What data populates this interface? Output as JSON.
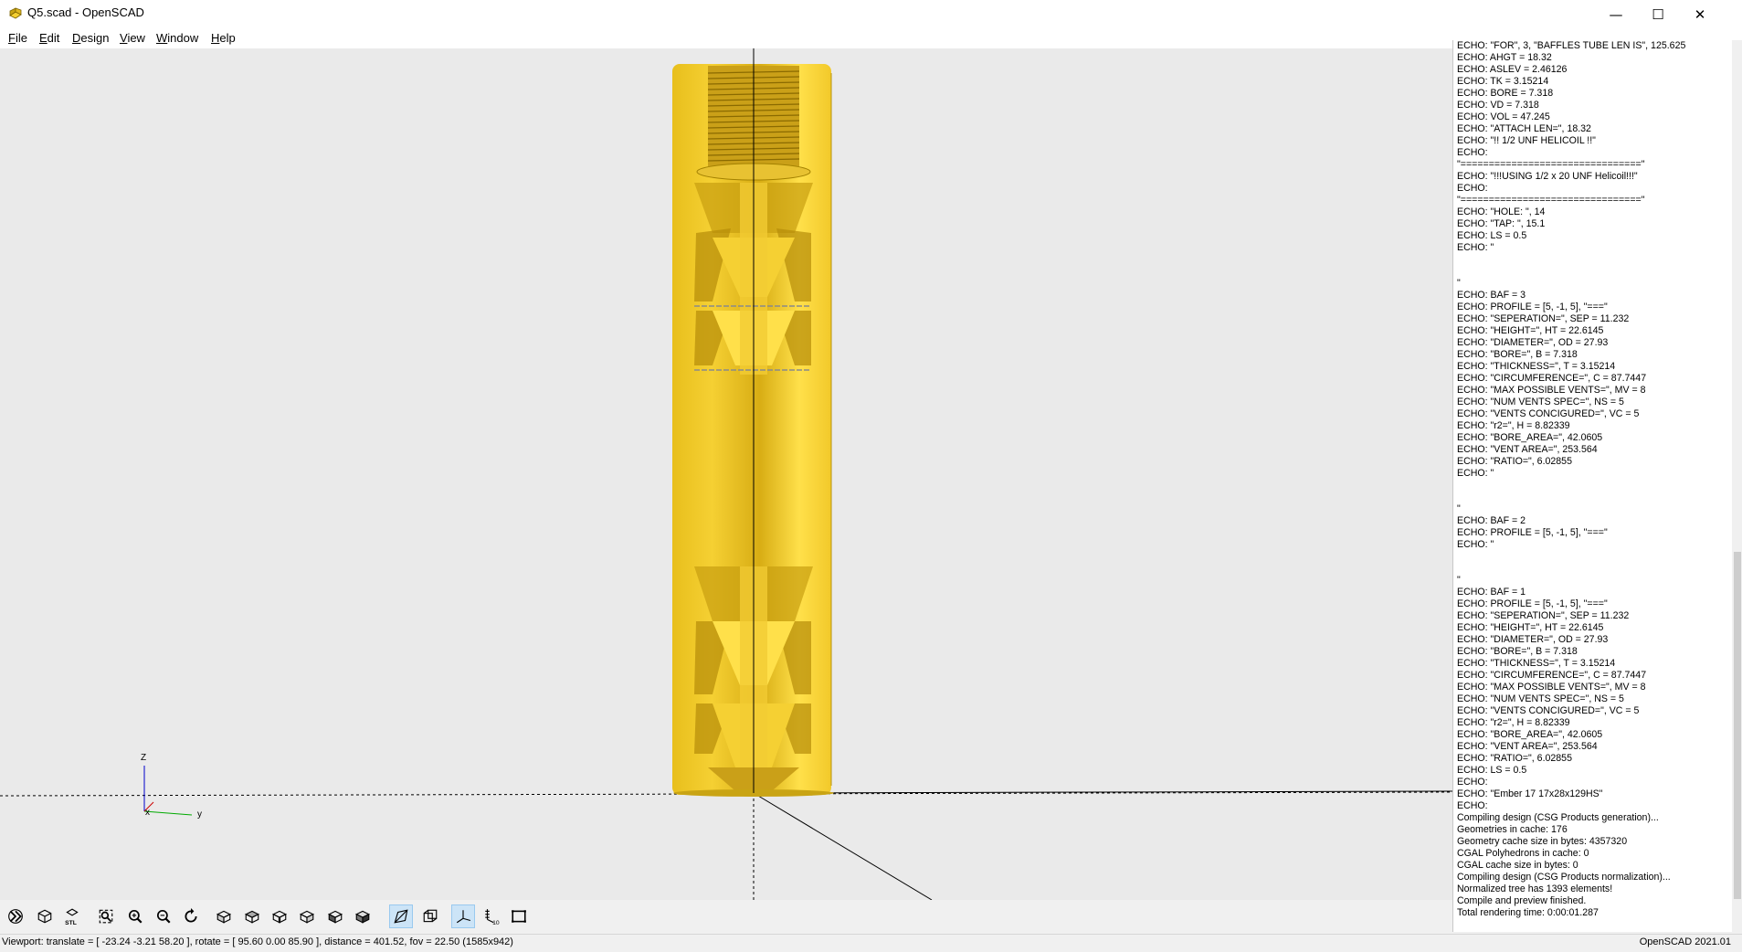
{
  "window": {
    "title": "Q5.scad - OpenSCAD",
    "minimize_glyph": "—",
    "maximize_glyph": "☐",
    "close_glyph": "✕"
  },
  "menu": {
    "items": [
      {
        "mnemonic": "F",
        "rest": "ile"
      },
      {
        "mnemonic": "E",
        "rest": "dit"
      },
      {
        "mnemonic": "D",
        "rest": "esign"
      },
      {
        "mnemonic": "V",
        "rest": "iew"
      },
      {
        "mnemonic": "W",
        "rest": "indow"
      },
      {
        "mnemonic": "H",
        "rest": "elp"
      }
    ]
  },
  "axes": {
    "z": "Z",
    "x": "x",
    "y": "y"
  },
  "model": {
    "color": "#f5d033",
    "shade": "#c9a414",
    "highlight": "#ffe866"
  },
  "console": {
    "lines": [
      "ECHO: \"FOR\", 3, \"BAFFLES TUBE LEN IS\", 125.625",
      "ECHO: AHGT = 18.32",
      "ECHO: ASLEV = 2.46126",
      "ECHO: TK = 3.15214",
      "ECHO: BORE = 7.318",
      "ECHO: VD = 7.318",
      "ECHO: VOL = 47.245",
      "ECHO: \"ATTACH LEN=\", 18.32",
      "ECHO: \"!! 1/2 UNF HELICOIL !!\"",
      "ECHO:",
      "\"================================\"",
      "ECHO: \"!!!USING 1/2 x 20 UNF Helicoil!!!\"",
      "ECHO:",
      "\"================================\"",
      "ECHO: \"HOLE: \", 14",
      "ECHO: \"TAP: \", 15.1",
      "ECHO: LS = 0.5",
      "ECHO: \"",
      "",
      "",
      "\"",
      "ECHO: BAF = 3",
      "ECHO: PROFILE = [5, -1, 5], \"===\"",
      "ECHO: \"SEPERATION=\", SEP = 11.232",
      "ECHO: \"HEIGHT=\", HT = 22.6145",
      "ECHO: \"DIAMETER=\", OD = 27.93",
      "ECHO: \"BORE=\", B = 7.318",
      "ECHO: \"THICKNESS=\", T = 3.15214",
      "ECHO: \"CIRCUMFERENCE=\", C = 87.7447",
      "ECHO: \"MAX POSSIBLE VENTS=\", MV = 8",
      "ECHO: \"NUM VENTS SPEC=\", NS = 5",
      "ECHO: \"VENTS CONCIGURED=\", VC = 5",
      "ECHO: \"r2=\", H = 8.82339",
      "ECHO: \"BORE_AREA=\", 42.0605",
      "ECHO: \"VENT AREA=\", 253.564",
      "ECHO: \"RATIO=\", 6.02855",
      "ECHO: \"",
      "",
      "",
      "\"",
      "ECHO: BAF = 2",
      "ECHO: PROFILE = [5, -1, 5], \"===\"",
      "ECHO: \"",
      "",
      "",
      "\"",
      "ECHO: BAF = 1",
      "ECHO: PROFILE = [5, -1, 5], \"===\"",
      "ECHO: \"SEPERATION=\", SEP = 11.232",
      "ECHO: \"HEIGHT=\", HT = 22.6145",
      "ECHO: \"DIAMETER=\", OD = 27.93",
      "ECHO: \"BORE=\", B = 7.318",
      "ECHO: \"THICKNESS=\", T = 3.15214",
      "ECHO: \"CIRCUMFERENCE=\", C = 87.7447",
      "ECHO: \"MAX POSSIBLE VENTS=\", MV = 8",
      "ECHO: \"NUM VENTS SPEC=\", NS = 5",
      "ECHO: \"VENTS CONCIGURED=\", VC = 5",
      "ECHO: \"r2=\", H = 8.82339",
      "ECHO: \"BORE_AREA=\", 42.0605",
      "ECHO: \"VENT AREA=\", 253.564",
      "ECHO: \"RATIO=\", 6.02855",
      "ECHO: LS = 0.5",
      "ECHO:",
      "ECHO: \"Ember 17 17x28x129HS\"",
      "ECHO:",
      "Compiling design (CSG Products generation)...",
      "Geometries in cache: 176",
      "Geometry cache size in bytes: 4357320",
      "CGAL Polyhedrons in cache: 0",
      "CGAL cache size in bytes: 0",
      "Compiling design (CSG Products normalization)...",
      "Normalized tree has 1393 elements!",
      "Compile and preview finished.",
      "Total rendering time: 0:00:01.287"
    ]
  },
  "toolbar": {
    "buttons": [
      {
        "name": "animate-button",
        "icon": "animate-icon",
        "active": false
      },
      {
        "name": "render-button",
        "icon": "render-cube-icon",
        "active": false
      },
      {
        "name": "export-stl-button",
        "icon": "stl-icon",
        "label": "STL",
        "active": false
      },
      {
        "name": "view-all-button",
        "icon": "view-all-icon",
        "active": false
      },
      {
        "name": "zoom-in-button",
        "icon": "zoom-in-icon",
        "active": false
      },
      {
        "name": "zoom-out-button",
        "icon": "zoom-out-icon",
        "active": false
      },
      {
        "name": "reset-view-button",
        "icon": "reset-view-icon",
        "active": false
      },
      {
        "name": "view-right-button",
        "icon": "view-right-icon",
        "active": false
      },
      {
        "name": "view-top-button",
        "icon": "view-top-icon",
        "active": false
      },
      {
        "name": "view-bottom-button",
        "icon": "view-bottom-icon",
        "active": false
      },
      {
        "name": "view-left-button",
        "icon": "view-left-icon",
        "active": false
      },
      {
        "name": "view-front-button",
        "icon": "view-front-icon",
        "active": false
      },
      {
        "name": "view-back-button",
        "icon": "view-back-icon",
        "active": false
      },
      {
        "name": "perspective-button",
        "icon": "perspective-icon",
        "active": true
      },
      {
        "name": "orthogonal-button",
        "icon": "orthogonal-icon",
        "active": false
      },
      {
        "name": "show-axes-button",
        "icon": "axes-icon",
        "active": true
      },
      {
        "name": "show-scale-markers-button",
        "icon": "scale-markers-icon",
        "label": "10",
        "active": false
      },
      {
        "name": "show-edges-button",
        "icon": "edges-icon",
        "active": false
      }
    ]
  },
  "status": {
    "viewport": "Viewport: translate = [ -23.24 -3.21 58.20 ], rotate = [ 95.60 0.00 85.90 ], distance = 401.52, fov = 22.50 (1585x942)",
    "version": "OpenSCAD 2021.01"
  }
}
